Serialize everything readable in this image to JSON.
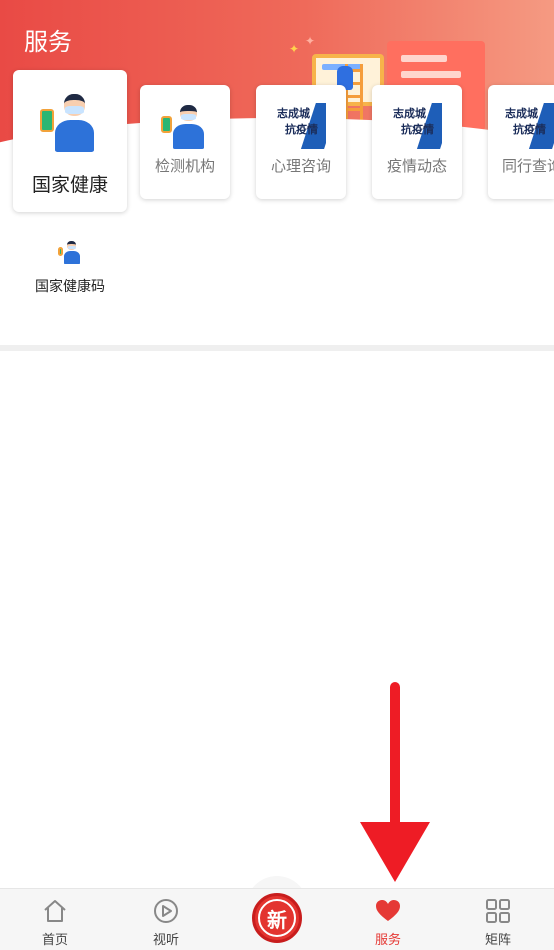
{
  "header": {
    "title": "服务"
  },
  "cards": [
    {
      "label": "国家健康",
      "image": "health-code-person"
    },
    {
      "label": "检测机构",
      "image": "health-code-person"
    },
    {
      "label": "心理咨询",
      "image": "anti-epidemic-banner",
      "banner_line1": "志成城",
      "banner_line2": "抗疫情"
    },
    {
      "label": "疫情动态",
      "image": "anti-epidemic-banner",
      "banner_line1": "志成城",
      "banner_line2": "抗疫情"
    },
    {
      "label": "同行查询",
      "image": "anti-epidemic-banner",
      "banner_line1": "志成城",
      "banner_line2": "抗疫情"
    }
  ],
  "services": [
    {
      "label": "国家健康码",
      "icon": "health-code-person"
    }
  ],
  "tabbar": {
    "items": [
      {
        "label": "首页",
        "icon": "home-icon",
        "active": false
      },
      {
        "label": "视听",
        "icon": "play-icon",
        "active": false
      },
      {
        "label": "",
        "icon": "brand-logo",
        "active": false,
        "logo_text": "新"
      },
      {
        "label": "服务",
        "icon": "heart-icon",
        "active": true
      },
      {
        "label": "矩阵",
        "icon": "grid-icon",
        "active": false
      }
    ]
  },
  "colors": {
    "accent": "#e53935",
    "header_start": "#e94a45",
    "header_end": "#f59a82",
    "arrow": "#ee1c25"
  }
}
